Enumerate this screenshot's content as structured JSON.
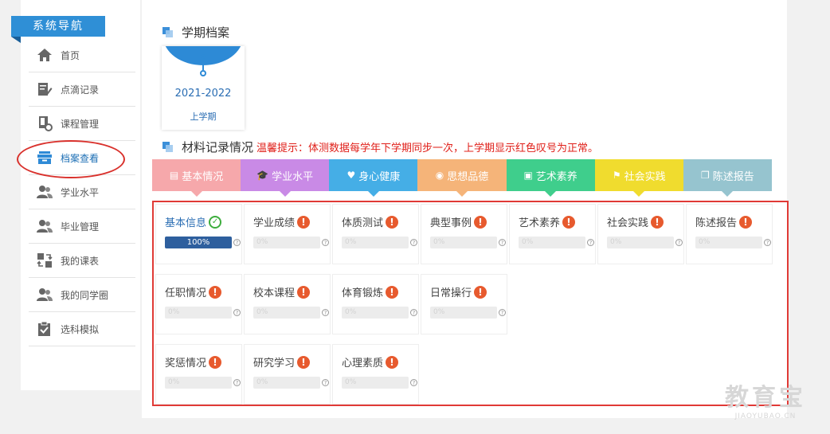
{
  "sidebar": {
    "title": "系统导航",
    "items": [
      {
        "label": "首页",
        "icon": "home-icon"
      },
      {
        "label": "点滴记录",
        "icon": "edit-note-icon"
      },
      {
        "label": "课程管理",
        "icon": "course-settings-icon"
      },
      {
        "label": "档案查看",
        "icon": "archive-box-icon",
        "active": true
      },
      {
        "label": "学业水平",
        "icon": "users-icon"
      },
      {
        "label": "毕业管理",
        "icon": "users-icon"
      },
      {
        "label": "我的课表",
        "icon": "swap-schedule-icon"
      },
      {
        "label": "我的同学圈",
        "icon": "users-icon"
      },
      {
        "label": "选科模拟",
        "icon": "checklist-icon"
      }
    ]
  },
  "archive": {
    "title": "学期档案",
    "semester": {
      "year": "2021-2022",
      "term": "上学期"
    }
  },
  "materials": {
    "title": "材料记录情况",
    "tip": "温馨提示：体测数据每学年下学期同步一次，上学期显示红色叹号为正常。"
  },
  "tabs": [
    {
      "label": "基本情况",
      "icon": "document-icon",
      "color": "#f6a8ab"
    },
    {
      "label": "学业水平",
      "icon": "graduation-cap-icon",
      "color": "#c98ae6"
    },
    {
      "label": "身心健康",
      "icon": "heartbeat-icon",
      "color": "#45aee6"
    },
    {
      "label": "思想品德",
      "icon": "lifebuoy-icon",
      "color": "#f5b479"
    },
    {
      "label": "艺术素养",
      "icon": "picture-icon",
      "color": "#3fce8c"
    },
    {
      "label": "社会实践",
      "icon": "flag-icon",
      "color": "#f0dc2e"
    },
    {
      "label": "陈述报告",
      "icon": "copy-icon",
      "color": "#96c4cf"
    }
  ],
  "cells": [
    {
      "name": "基本信息",
      "status": "ok",
      "progress": "100%",
      "progress_value": 100
    },
    {
      "name": "学业成绩",
      "status": "warn",
      "progress": "0%",
      "progress_value": 0
    },
    {
      "name": "体质测试",
      "status": "warn",
      "progress": "0%",
      "progress_value": 0
    },
    {
      "name": "典型事例",
      "status": "warn",
      "progress": "0%",
      "progress_value": 0
    },
    {
      "name": "艺术素养",
      "status": "warn",
      "progress": "0%",
      "progress_value": 0
    },
    {
      "name": "社会实践",
      "status": "warn",
      "progress": "0%",
      "progress_value": 0
    },
    {
      "name": "陈述报告",
      "status": "warn",
      "progress": "0%",
      "progress_value": 0
    },
    {
      "name": "任职情况",
      "status": "warn",
      "progress": "0%",
      "progress_value": 0
    },
    {
      "name": "校本课程",
      "status": "warn",
      "progress": "0%",
      "progress_value": 0
    },
    {
      "name": "体育锻炼",
      "status": "warn",
      "progress": "0%",
      "progress_value": 0
    },
    {
      "name": "日常操行",
      "status": "warn",
      "progress": "0%",
      "progress_value": 0
    },
    {
      "name": "奖惩情况",
      "status": "warn",
      "progress": "0%",
      "progress_value": 0
    },
    {
      "name": "研究学习",
      "status": "warn",
      "progress": "0%",
      "progress_value": 0
    },
    {
      "name": "心理素质",
      "status": "warn",
      "progress": "0%",
      "progress_value": 0
    }
  ],
  "watermark": {
    "line1": "教育宝",
    "line2": "JIAOYUBAO.CN"
  }
}
